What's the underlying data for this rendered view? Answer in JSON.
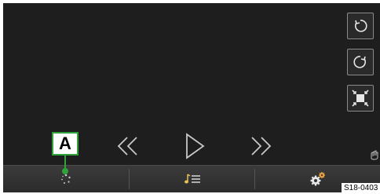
{
  "side_buttons": [
    {
      "icon": "rotate-counterclockwise-icon"
    },
    {
      "icon": "rotate-clockwise-icon"
    },
    {
      "icon": "collapse-fullscreen-icon"
    }
  ],
  "transport": {
    "rewind_icon": "rewind-icon",
    "play_icon": "play-icon",
    "fast_forward_icon": "fast-forward-icon"
  },
  "gesture_icon": "hand-swipe-icon",
  "bottom_bar": {
    "tabs": [
      {
        "icon": "spinner-dots-icon"
      },
      {
        "icon": "playlist-icon"
      },
      {
        "icon": "settings-gears-icon"
      }
    ]
  },
  "callout": {
    "label": "A"
  },
  "reference_code": "S18-0403",
  "colors": {
    "background": "#1e1e1e",
    "icon": "#c8c8c8",
    "callout_accent": "#2fa23a",
    "settings_accent": "#e8a33d"
  }
}
